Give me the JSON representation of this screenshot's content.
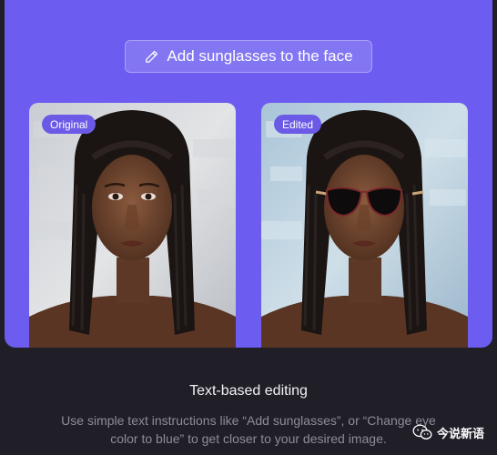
{
  "hero": {
    "prompt_text": "Add sunglasses to the face",
    "prompt_icon": "pencil-icon",
    "accent_color": "#6c5cf0",
    "original_label": "Original",
    "edited_label": "Edited"
  },
  "feature": {
    "title": "Text-based editing",
    "description": "Use simple text instructions like “Add sunglasses”, or “Change eye color to blue” to get closer to your desired image."
  },
  "watermark": {
    "icon": "wechat-icon",
    "text": "今说新语"
  }
}
